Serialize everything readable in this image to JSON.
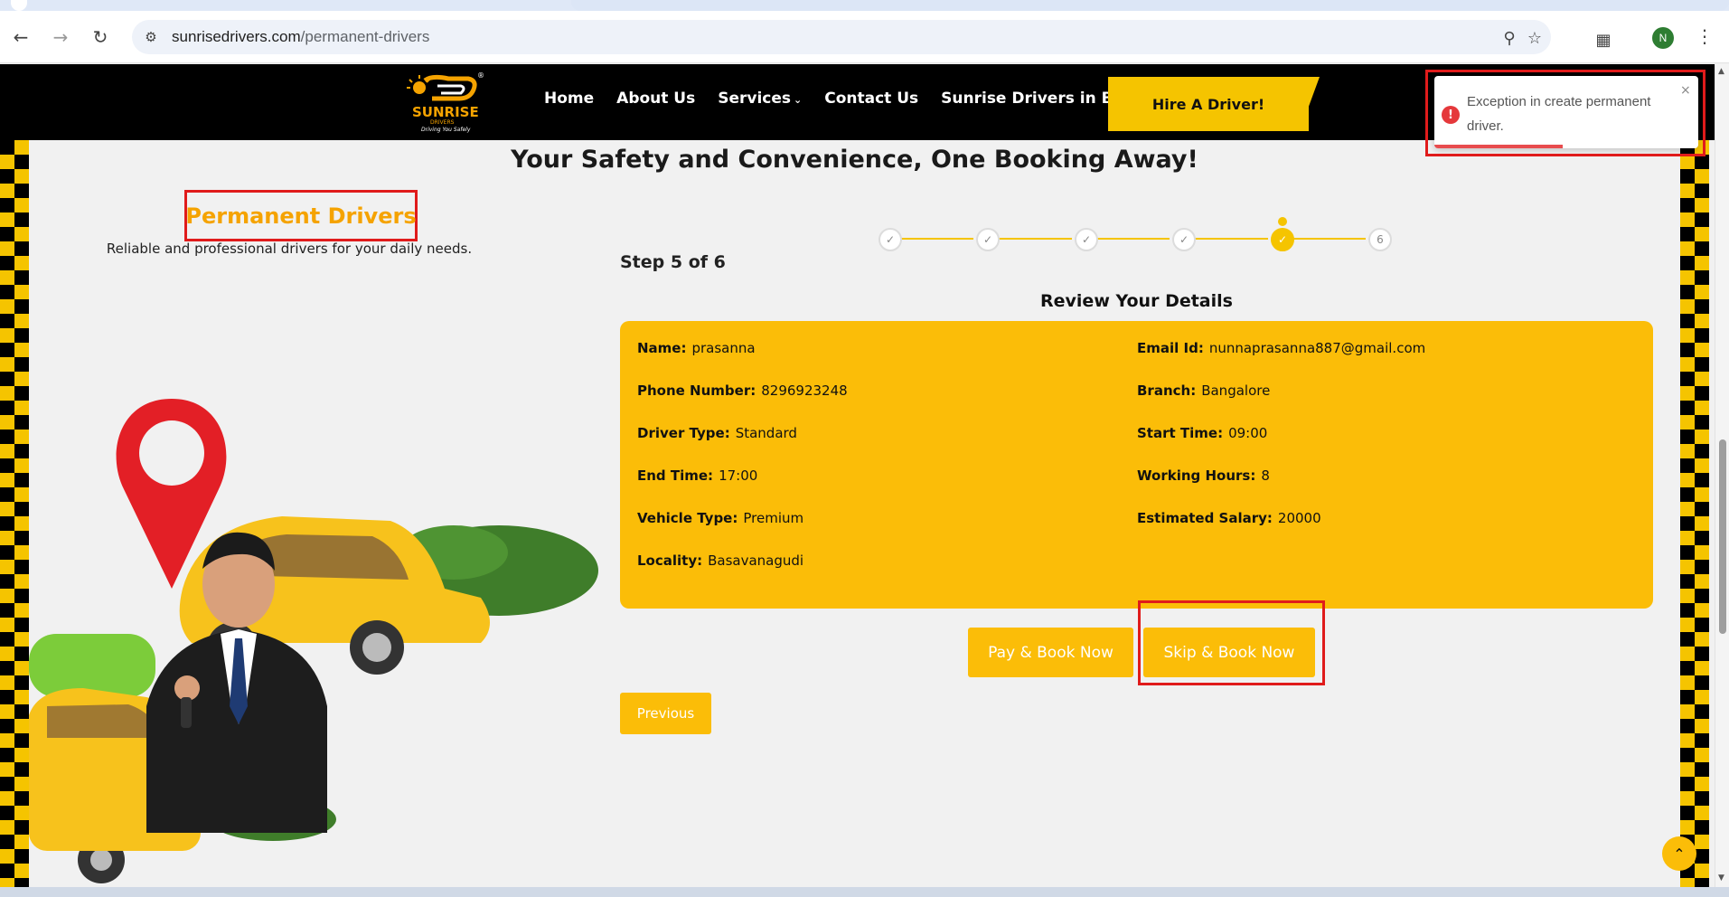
{
  "browser": {
    "url_host": "sunrisedrivers.com",
    "url_path": "/permanent-drivers",
    "profile_initial": "N",
    "icons": {
      "back": "arrow-left-icon",
      "forward": "arrow-right-icon",
      "reload": "reload-icon",
      "site_info": "tune-icon",
      "zoom": "zoom-icon",
      "bookmark": "star-icon",
      "extensions": "puzzle-icon",
      "menu": "kebab-icon"
    }
  },
  "header": {
    "logo_word": "SUNRISE",
    "logo_sub": "DRIVERS",
    "logo_tagline": "Driving You Safely",
    "logo_reg": "®",
    "nav": [
      {
        "label": "Home"
      },
      {
        "label": "About Us"
      },
      {
        "label": "Services",
        "has_dropdown": true
      },
      {
        "label": "Contact Us"
      },
      {
        "label": "Sunrise Drivers in Bangalore"
      }
    ],
    "cta_label": "Hire A Driver!"
  },
  "hero": {
    "headline": "Your Safety and Convenience, One Booking Away!",
    "left_title": "Permanent Drivers",
    "left_subtitle": "Reliable and professional drivers for your daily needs."
  },
  "stepper": {
    "steps": [
      {
        "state": "done",
        "mark": "✓"
      },
      {
        "state": "done",
        "mark": "✓"
      },
      {
        "state": "done",
        "mark": "✓"
      },
      {
        "state": "done",
        "mark": "✓"
      },
      {
        "state": "active",
        "mark": "✓"
      },
      {
        "state": "pending",
        "mark": "6"
      }
    ],
    "label": "Step 5 of 6"
  },
  "review": {
    "title": "Review Your Details",
    "left_fields": [
      {
        "label": "Name:",
        "value": "prasanna"
      },
      {
        "label": "Phone Number:",
        "value": "8296923248"
      },
      {
        "label": "Driver Type:",
        "value": "Standard"
      },
      {
        "label": "End Time:",
        "value": "17:00"
      },
      {
        "label": "Vehicle Type:",
        "value": "Premium"
      },
      {
        "label": "Locality:",
        "value": "Basavanagudi"
      }
    ],
    "right_fields": [
      {
        "label": "Email Id:",
        "value": "nunnaprasanna887@gmail.com"
      },
      {
        "label": "Branch:",
        "value": "Bangalore"
      },
      {
        "label": "Start Time:",
        "value": "09:00"
      },
      {
        "label": "Working Hours:",
        "value": "8"
      },
      {
        "label": "Estimated Salary:",
        "value": "20000"
      }
    ]
  },
  "actions": {
    "pay_label": "Pay & Book Now",
    "skip_label": "Skip & Book Now",
    "previous_label": "Previous"
  },
  "toast": {
    "message": "Exception in create permanent driver.",
    "icon": "error-icon",
    "close": "×",
    "type": "error"
  },
  "colors": {
    "brand_yellow": "#fbbd08",
    "header_bg": "#000000",
    "annotation_red": "#e01b1b",
    "error_red": "#e5383b"
  }
}
